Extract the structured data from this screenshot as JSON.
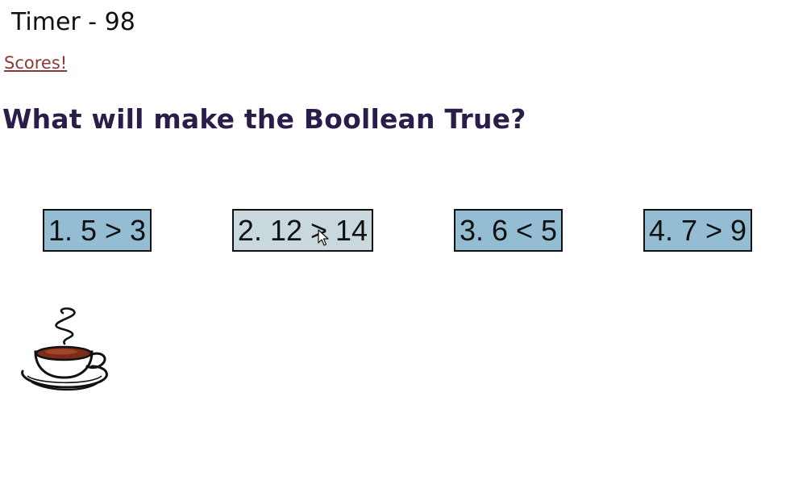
{
  "header": {
    "timer": "Timer - 98",
    "scores_link": "Scores!"
  },
  "question": {
    "text": "What will make the Boollean True?"
  },
  "answers": [
    {
      "label": "1. 5 > 3",
      "state": "normal"
    },
    {
      "label": "2. 12 > 14",
      "state": "hovered"
    },
    {
      "label": "3. 6 < 5",
      "state": "normal"
    },
    {
      "label": "4. 7 > 9",
      "state": "normal"
    }
  ],
  "icons": {
    "coffee": "coffee-cup-icon",
    "cursor": "mouse-pointer-icon"
  },
  "colors": {
    "answer_bg": "#94bcd3",
    "answer_hover_bg": "#c9d8dd",
    "question_text": "#2b1d4a",
    "link": "#8b3a3a"
  }
}
